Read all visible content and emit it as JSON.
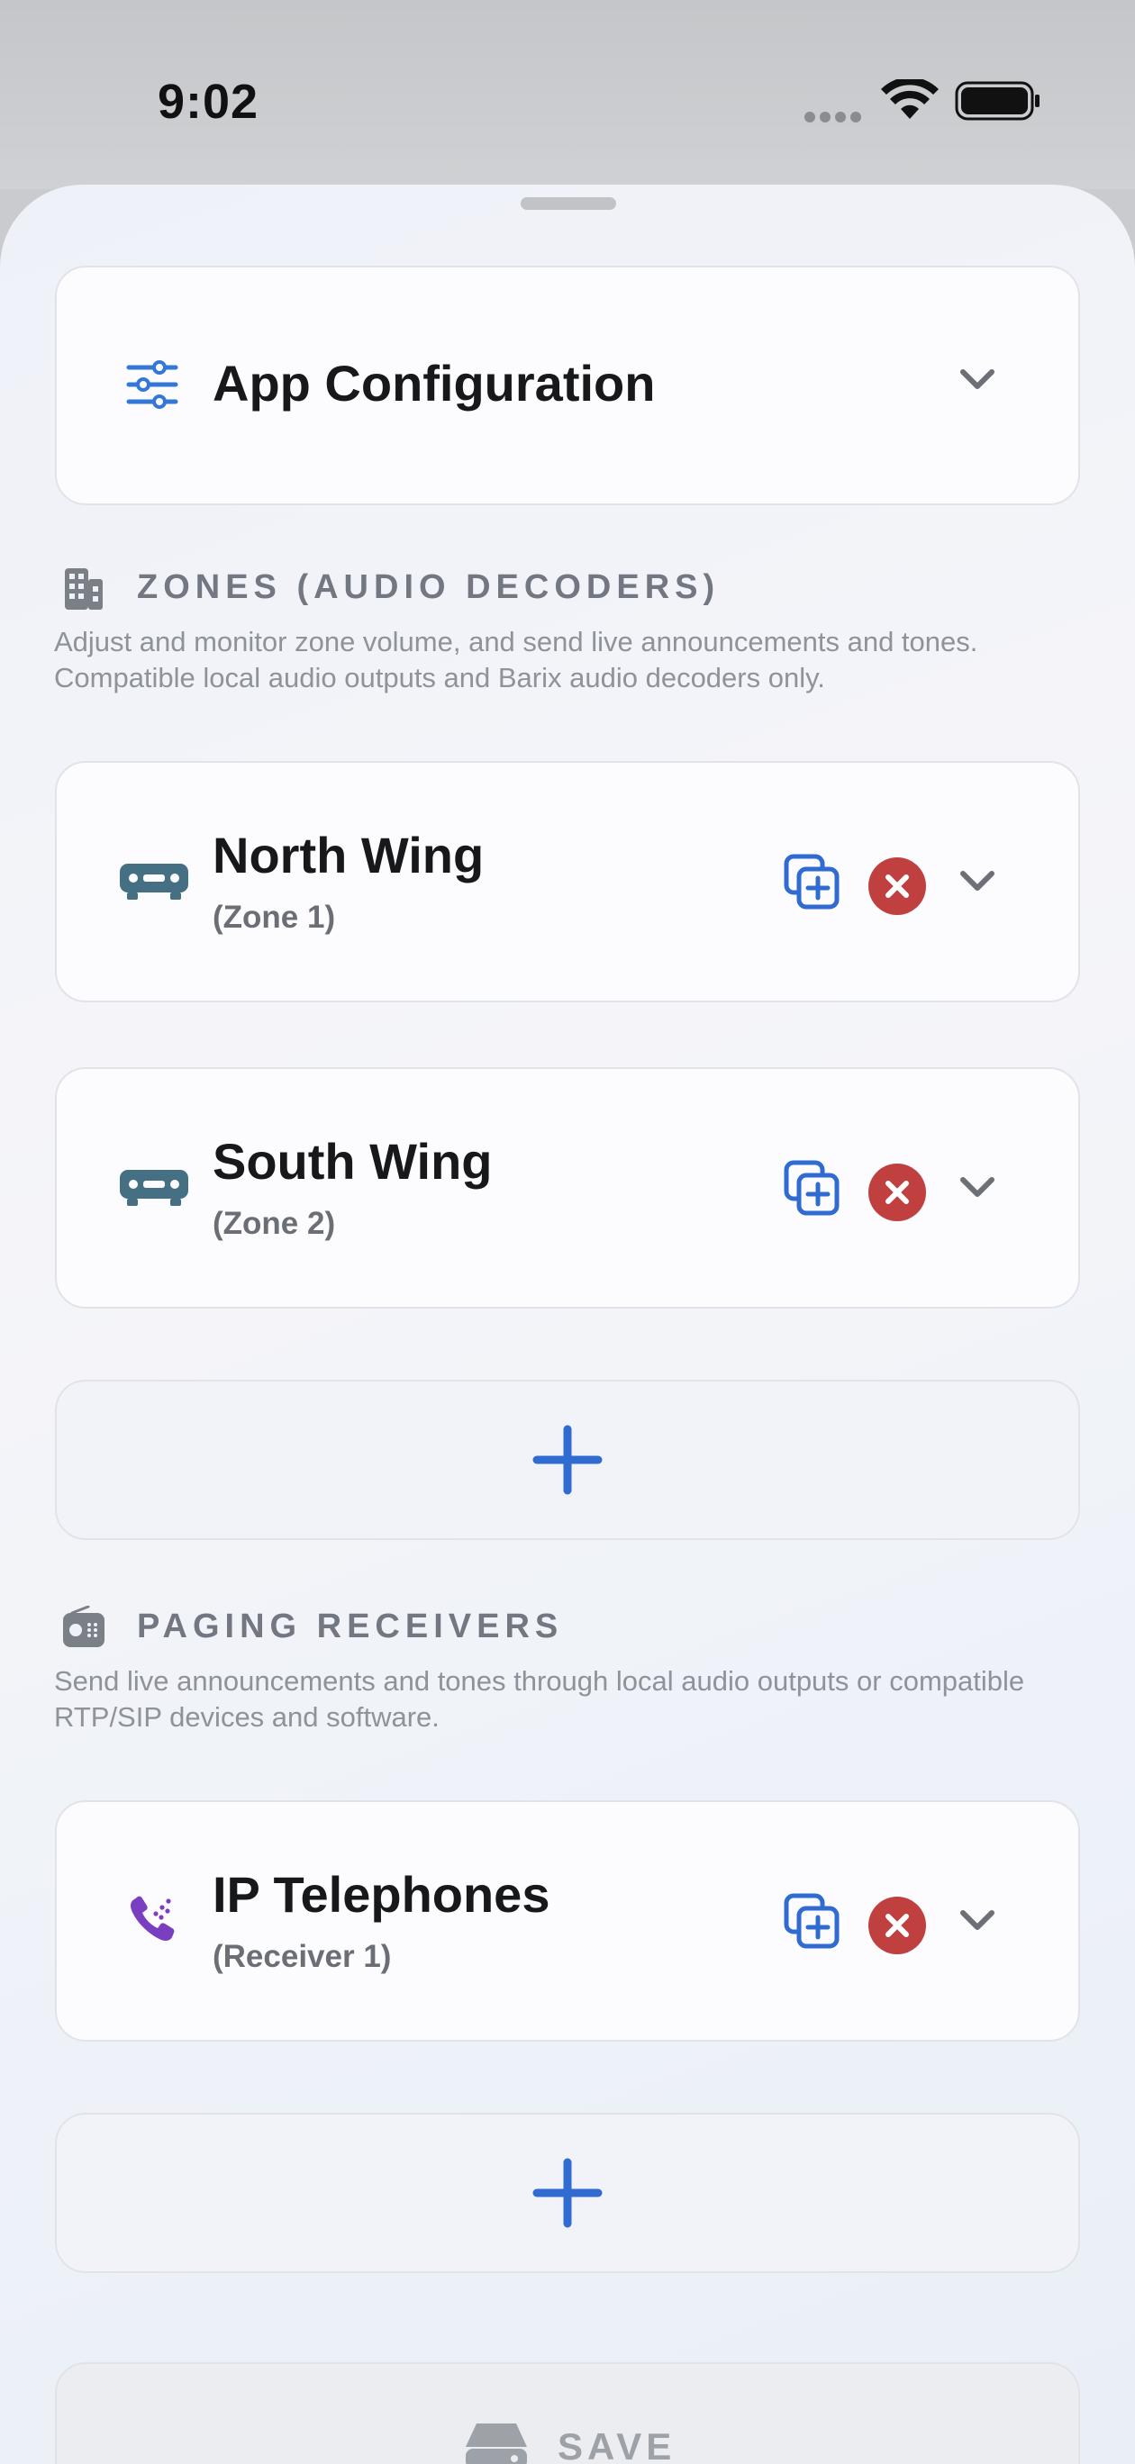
{
  "status_bar": {
    "time": "9:02"
  },
  "app_config": {
    "title": "App Configuration"
  },
  "zones": {
    "heading": "ZONES (AUDIO DECODERS)",
    "description": "Adjust and monitor zone volume, and send live announcements and tones. Compatible local audio outputs and Barix audio decoders only.",
    "items": [
      {
        "name": "North Wing",
        "subtitle": "(Zone 1)"
      },
      {
        "name": "South Wing",
        "subtitle": "(Zone 2)"
      }
    ]
  },
  "paging": {
    "heading": "PAGING RECEIVERS",
    "description": "Send live announcements and tones through local audio outputs or compatible RTP/SIP devices and software.",
    "items": [
      {
        "name": "IP Telephones",
        "subtitle": "(Receiver 1)"
      }
    ]
  },
  "save": {
    "label": "SAVE"
  },
  "colors": {
    "accent_blue": "#2f6bd0",
    "delete_red": "#c0403f",
    "device_teal": "#457083",
    "phone_purple": "#7a3fc0"
  },
  "icons": {
    "config": "sliders-icon",
    "zones_section": "building-icon",
    "paging_section": "radio-icon",
    "zone_item": "audio-decoder-icon",
    "receiver_item": "phone-icon",
    "duplicate": "duplicate-icon",
    "delete": "delete-icon",
    "expand": "chevron-down-icon",
    "add": "plus-icon",
    "save": "drive-icon"
  }
}
